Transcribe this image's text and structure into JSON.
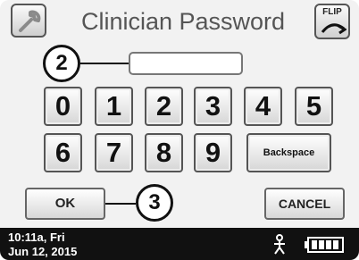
{
  "header": {
    "title": "Clinician Password",
    "flip_label": "FLIP",
    "wrench_icon": "wrench-icon"
  },
  "password": {
    "value": ""
  },
  "keypad": {
    "row1": [
      "0",
      "1",
      "2",
      "3",
      "4",
      "5"
    ],
    "row2": [
      "6",
      "7",
      "8",
      "9"
    ],
    "backspace_label": "Backspace"
  },
  "actions": {
    "ok_label": "OK",
    "cancel_label": "CANCEL"
  },
  "callouts": {
    "password_marker": "2",
    "ok_marker": "3"
  },
  "status_bar": {
    "time": "10:11a, Fri",
    "date": "Jun 12, 2015",
    "person_icon": "person-icon",
    "battery_icon": "battery-icon"
  },
  "colors": {
    "status_bar_bg": "#111111",
    "screen_bg": "#f2f2f2"
  }
}
